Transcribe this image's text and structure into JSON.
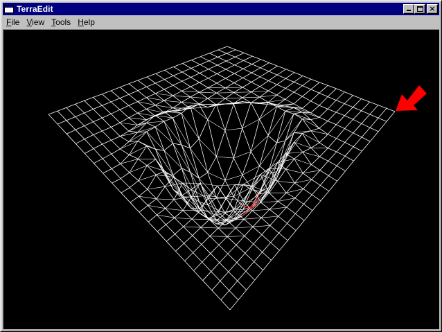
{
  "window": {
    "title": "TerraEdit",
    "minimize_glyph": "",
    "maximize_glyph": "",
    "close_glyph": "×"
  },
  "menu": [
    {
      "first": "F",
      "rest": "ile"
    },
    {
      "first": "V",
      "rest": "iew"
    },
    {
      "first": "T",
      "rest": "ools"
    },
    {
      "first": "H",
      "rest": "elp"
    }
  ],
  "viewport": {
    "background": "#000000",
    "mesh_color": "#ffffff",
    "highlight_color": "#ff0000",
    "pointer_color": "#ff0000",
    "grid_divisions": 20,
    "icons": [
      "red-arrow-pointer-icon"
    ]
  }
}
